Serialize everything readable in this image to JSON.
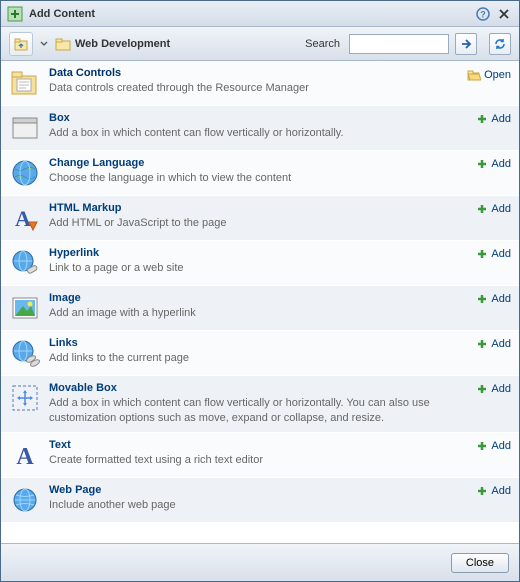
{
  "header": {
    "title": "Add Content"
  },
  "toolbar": {
    "path": "Web Development",
    "search_label": "Search",
    "search_value": ""
  },
  "actions": {
    "open": "Open",
    "add": "Add",
    "close": "Close"
  },
  "items": [
    {
      "title": "Data Controls",
      "desc": "Data controls created through the Resource Manager",
      "kind": "folder",
      "icon": "folder-docs-icon"
    },
    {
      "title": "Box",
      "desc": "Add a box in which content can flow vertically or horizontally.",
      "kind": "add",
      "icon": "box-icon"
    },
    {
      "title": "Change Language",
      "desc": "Choose the language in which to view the content",
      "kind": "add",
      "icon": "globe-icon"
    },
    {
      "title": "HTML Markup",
      "desc": "Add HTML or JavaScript to the page",
      "kind": "add",
      "icon": "html-a-icon"
    },
    {
      "title": "Hyperlink",
      "desc": "Link to a page or a web site",
      "kind": "add",
      "icon": "globe-link-icon"
    },
    {
      "title": "Image",
      "desc": "Add an image with a hyperlink",
      "kind": "add",
      "icon": "image-icon"
    },
    {
      "title": "Links",
      "desc": "Add links to the current page",
      "kind": "add",
      "icon": "links-icon"
    },
    {
      "title": "Movable Box",
      "desc": "Add a box in which content can flow vertically or horizontally. You can also use customization options such as move, expand or collapse, and resize.",
      "kind": "add",
      "icon": "movable-box-icon"
    },
    {
      "title": "Text",
      "desc": "Create formatted text using a rich text editor",
      "kind": "add",
      "icon": "text-a-icon"
    },
    {
      "title": "Web Page",
      "desc": "Include another web page",
      "kind": "add",
      "icon": "webpage-icon"
    }
  ]
}
